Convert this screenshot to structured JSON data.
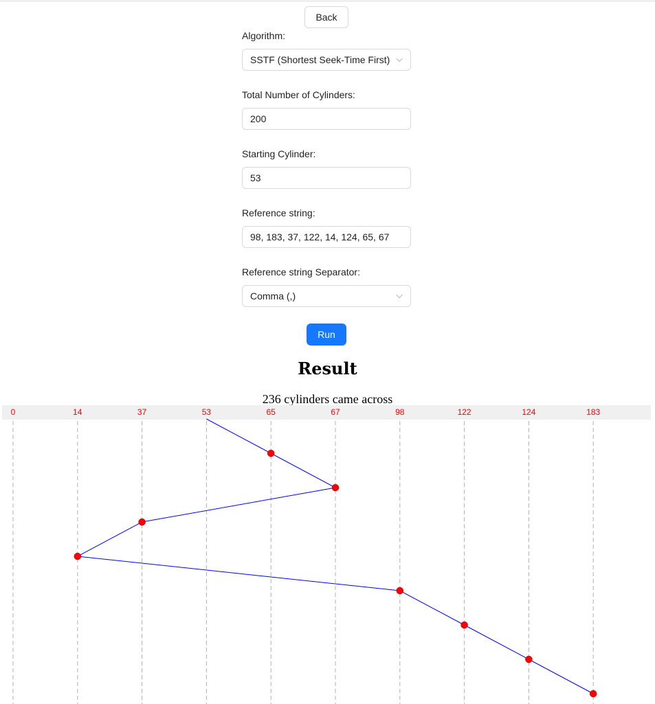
{
  "back_label": "Back",
  "form": {
    "algorithm": {
      "label": "Algorithm:",
      "value": "SSTF (Shortest Seek-Time First)"
    },
    "total_cylinders": {
      "label": "Total Number of Cylinders:",
      "value": "200"
    },
    "starting_cylinder": {
      "label": "Starting Cylinder:",
      "value": "53"
    },
    "reference_string": {
      "label": "Reference string:",
      "value": "98, 183, 37, 122, 14, 124, 65, 67"
    },
    "separator": {
      "label": "Reference string Separator:",
      "value": "Comma (,)"
    }
  },
  "run_label": "Run",
  "result": {
    "title": "Result",
    "summary": "236 cylinders came across"
  },
  "colors": {
    "primary": "#1677ff",
    "seek_line": "#0000ff",
    "point": "#ff0000",
    "tick_label": "#ff0000",
    "guide_line": "#b0b0b0"
  },
  "chart_data": {
    "type": "line",
    "axis_ticks": [
      "0",
      "14",
      "37",
      "53",
      "65",
      "67",
      "98",
      "122",
      "124",
      "183"
    ],
    "start": "53",
    "seek_sequence": [
      "65",
      "67",
      "37",
      "14",
      "98",
      "122",
      "124",
      "183"
    ],
    "total_movement": 236
  }
}
